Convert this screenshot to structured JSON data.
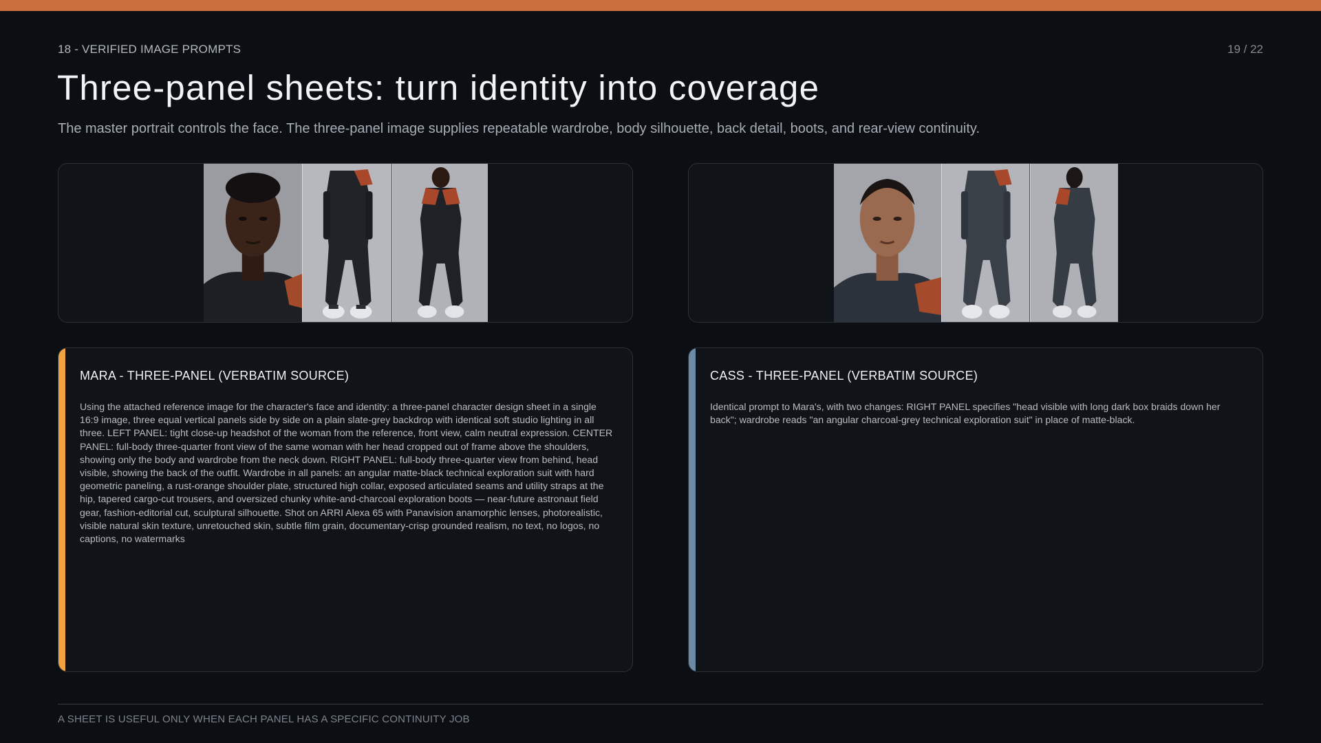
{
  "slide": {
    "section_label": "18 - VERIFIED IMAGE PROMPTS",
    "page_number": "19 / 22",
    "title": "Three-panel sheets: turn identity into coverage",
    "subtitle": "The master portrait controls the face. The three-panel image supplies repeatable wardrobe, body silhouette, back detail, boots, and rear-view continuity.",
    "footer": "A SHEET IS USEFUL ONLY WHEN EACH PANEL HAS A SPECIFIC CONTINUITY JOB"
  },
  "images": {
    "mara": {
      "panels": [
        "headshot",
        "front-body",
        "back-body"
      ]
    },
    "cass": {
      "panels": [
        "headshot",
        "front-body",
        "back-body"
      ]
    }
  },
  "cards": {
    "mara": {
      "heading": "MARA - THREE-PANEL (VERBATIM SOURCE)",
      "body": "Using the attached reference image for the character's face and identity: a three-panel character design sheet in a single 16:9 image, three equal vertical panels side by side on a plain slate-grey backdrop with identical soft studio lighting in all three. LEFT PANEL: tight close-up headshot of the woman from the reference, front view, calm neutral expression. CENTER PANEL: full-body three-quarter front view of the same woman with her head cropped out of frame above the shoulders, showing only the body and wardrobe from the neck down. RIGHT PANEL: full-body three-quarter view from behind, head visible, showing the back of the outfit. Wardrobe in all panels: an angular matte-black technical exploration suit with hard geometric paneling, a rust-orange shoulder plate, structured high collar, exposed articulated seams and utility straps at the hip, tapered cargo-cut trousers, and oversized chunky white-and-charcoal exploration boots — near-future astronaut field gear, fashion-editorial cut, sculptural silhouette. Shot on ARRI Alexa 65 with Panavision anamorphic lenses, photorealistic, visible natural skin texture, unretouched skin, subtle film grain, documentary-crisp grounded realism, no text, no logos, no captions, no watermarks",
      "accent_color": "#f0a23e"
    },
    "cass": {
      "heading": "CASS - THREE-PANEL (VERBATIM SOURCE)",
      "body": "Identical prompt to Mara's, with two changes: RIGHT PANEL specifies \"head visible with long dark box braids down her back\"; wardrobe reads \"an angular charcoal-grey technical exploration suit\" in place of matte-black.",
      "accent_color": "#6c8aa6"
    }
  },
  "colors": {
    "top_bar": "#cb6f3e",
    "background": "#0b0e12",
    "card_background": "#101317",
    "rust_accent": "#b9532f"
  }
}
